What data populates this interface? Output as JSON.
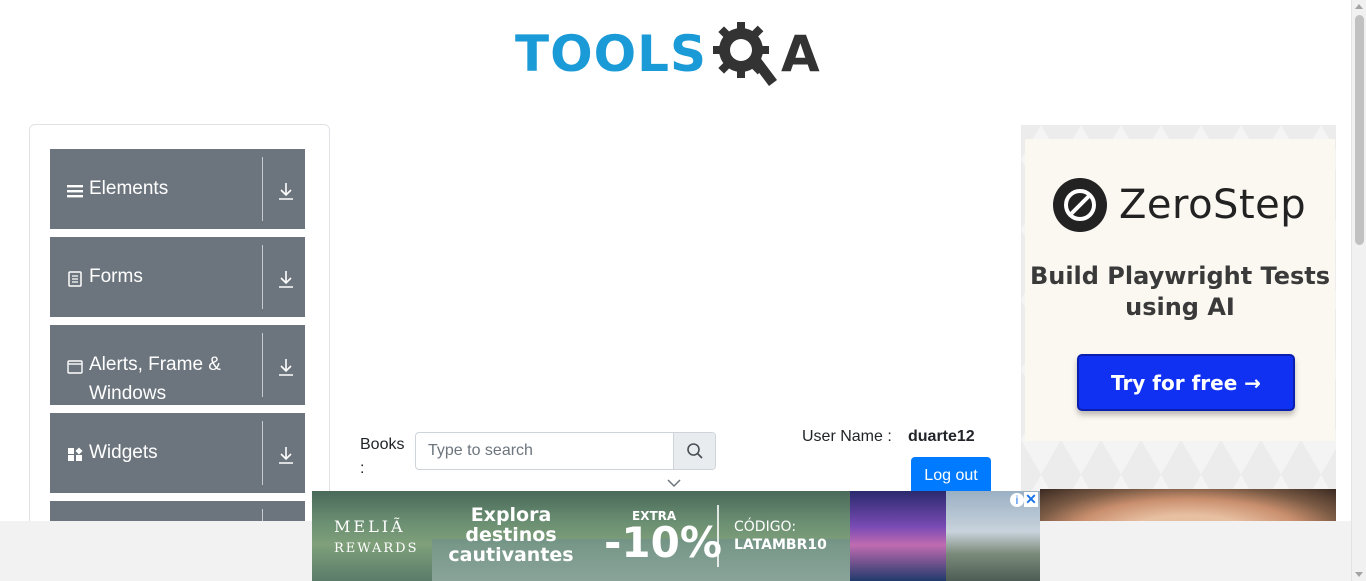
{
  "header": {
    "logo_tools": "TOOLS",
    "logo_a": "A",
    "logo_icon": "gear-magnifier-icon"
  },
  "sidebar": {
    "groups": [
      {
        "label": "Elements",
        "icon": "hamburger-icon"
      },
      {
        "label": "Forms",
        "icon": "document-icon"
      },
      {
        "label": "Alerts, Frame & Windows",
        "icon": "window-icon"
      },
      {
        "label": "Widgets",
        "icon": "widgets-icon"
      }
    ]
  },
  "books": {
    "label": "Books :",
    "search_placeholder": "Type to search",
    "search_value": ""
  },
  "user": {
    "label": "User Name :",
    "value": "duarte12",
    "logout_label": "Log out"
  },
  "side_ad": {
    "brand": "ZeroStep",
    "tagline": "Build Playwright Tests using AI",
    "cta": "Try for free →"
  },
  "banner_ad": {
    "brand_line1": "MELIÃ",
    "brand_line2": "REWARDS",
    "headline": "Explora destinos cautivantes",
    "extra": "EXTRA",
    "discount": "-10%",
    "code_label": "CÓDIGO:",
    "code": "LATAMBR10",
    "adchoices": "i",
    "close": "✕"
  },
  "colors": {
    "brand_blue": "#1a9ad6",
    "sidebar_group": "#6c757d",
    "primary_button": "#007bff",
    "ad_cta": "#1030f2"
  }
}
